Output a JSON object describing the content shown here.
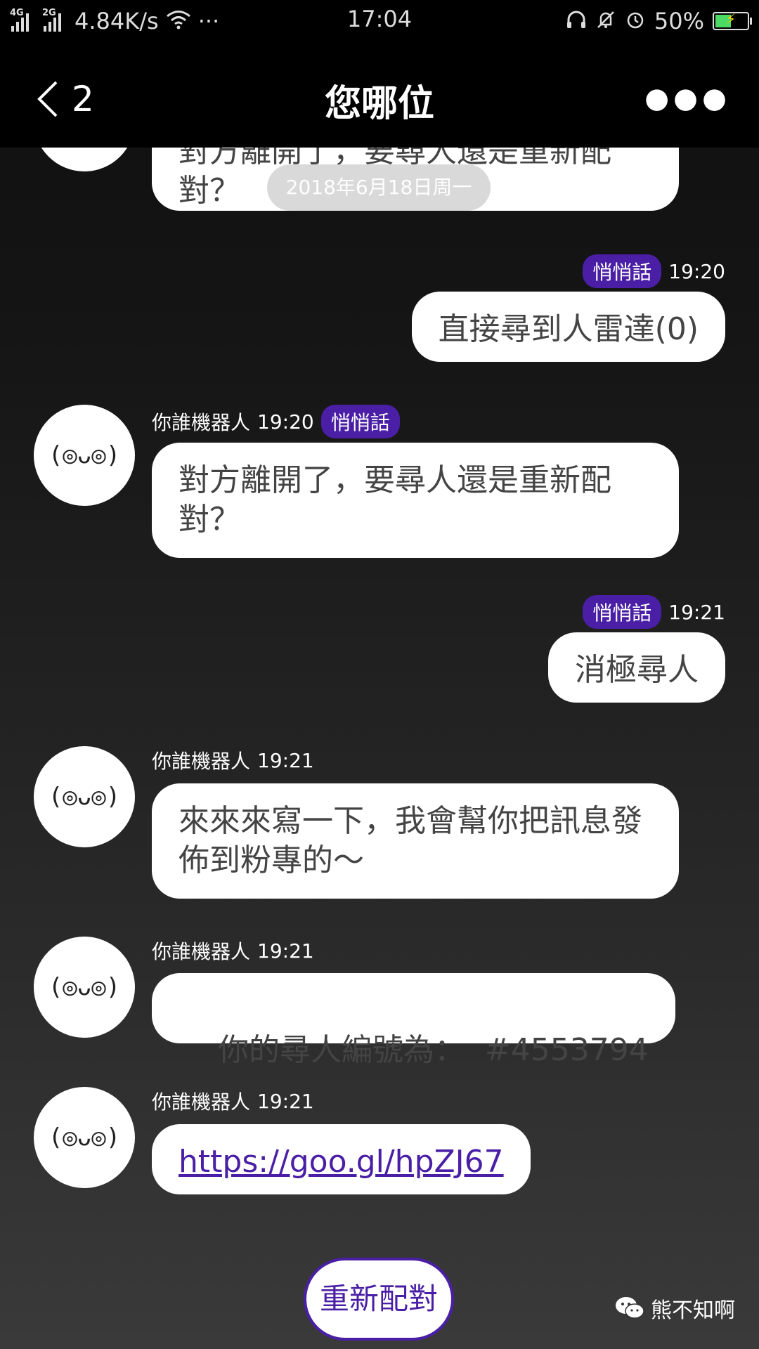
{
  "status_bar": {
    "net_4g": "4G",
    "net_2g": "2G",
    "speed": "4.84K/s",
    "dots": "···",
    "time": "17:04",
    "battery": "50%"
  },
  "header": {
    "back_count": "2",
    "title": "您哪位"
  },
  "chat": {
    "date_pill": "2018年6月18日周一",
    "partial_bubble": "對方離開了，要尋人還是重新配對？",
    "messages": [
      {
        "side": "right",
        "badge": "悄悄話",
        "time": "19:20",
        "text": "直接尋到人雷達(0)"
      },
      {
        "side": "left",
        "sender": "你誰機器人",
        "time": "19:20",
        "badge": "悄悄話",
        "text": "對方離開了，要尋人還是重新配對？"
      },
      {
        "side": "right",
        "badge": "悄悄話",
        "time": "19:21",
        "text": "消極尋人"
      },
      {
        "side": "left",
        "sender": "你誰機器人",
        "time": "19:21",
        "text": "來來來寫一下，我會幫你把訊息發佈到粉專的～"
      },
      {
        "side": "left",
        "sender": "你誰機器人",
        "time": "19:21",
        "text": "你的尋人編號為：  #4553794"
      },
      {
        "side": "left",
        "sender": "你誰機器人",
        "time": "19:21",
        "text": "https://goo.gl/hpZJ67"
      }
    ],
    "avatar_face": "(◎ᴗ◎)"
  },
  "rematch_button": "重新配對",
  "watermark": "熊不知啊",
  "colors": {
    "accent": "#4a1fa6"
  }
}
